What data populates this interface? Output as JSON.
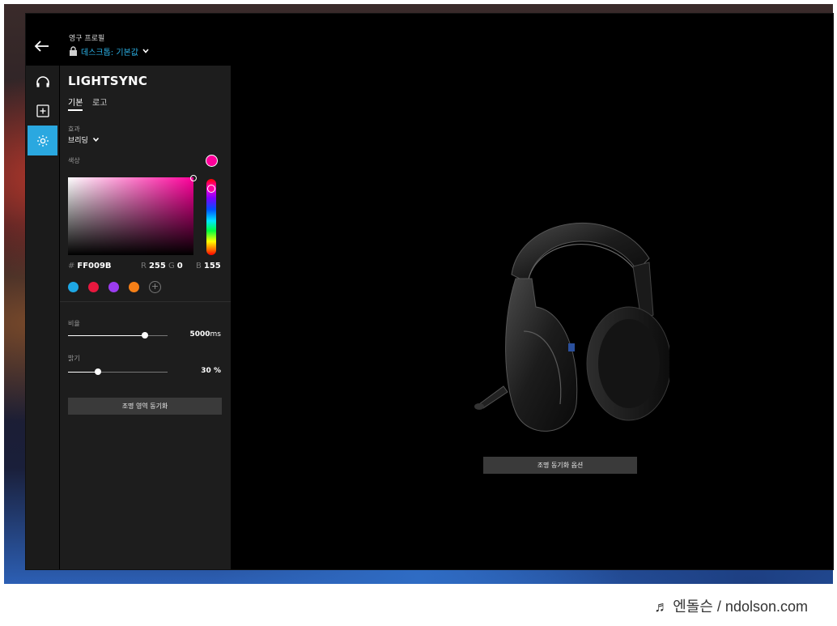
{
  "header": {
    "profile_label": "영구 프로필",
    "profile_name": "데스크톱: 기본값"
  },
  "rail": {
    "items": [
      {
        "icon": "headset-icon"
      },
      {
        "icon": "add-icon"
      },
      {
        "icon": "lightsync-icon",
        "active": true
      }
    ],
    "active_color": "#2aa8e0"
  },
  "panel": {
    "title": "LIGHTSYNC",
    "tabs": [
      {
        "label": "기본",
        "active": true
      },
      {
        "label": "로고",
        "active": false
      }
    ],
    "effect_label": "효과",
    "effect_value": "브리딩",
    "color_label": "색상",
    "current_color": "#FF009B",
    "hex_prefix": "#",
    "hex_value": "FF009B",
    "r_label": "R",
    "r_value": "255",
    "g_label": "G",
    "g_value": "0",
    "b_label": "B",
    "b_value": "155",
    "presets": [
      "#1ea7e4",
      "#e8183e",
      "#9b3cf0",
      "#f57f17"
    ],
    "add_preset_symbol": "+",
    "rate_label": "비율",
    "rate_value": "5000",
    "rate_unit": "ms",
    "rate_fraction": 0.77,
    "brightness_label": "밝기",
    "brightness_value": "30",
    "brightness_unit": "%",
    "brightness_fraction": 0.3,
    "sync_area_button": "조명 영역 동기화"
  },
  "main": {
    "sync_options_button": "조명 동기화 옵션"
  },
  "watermark": "♬ 엔돌슨 / ndolson.com"
}
